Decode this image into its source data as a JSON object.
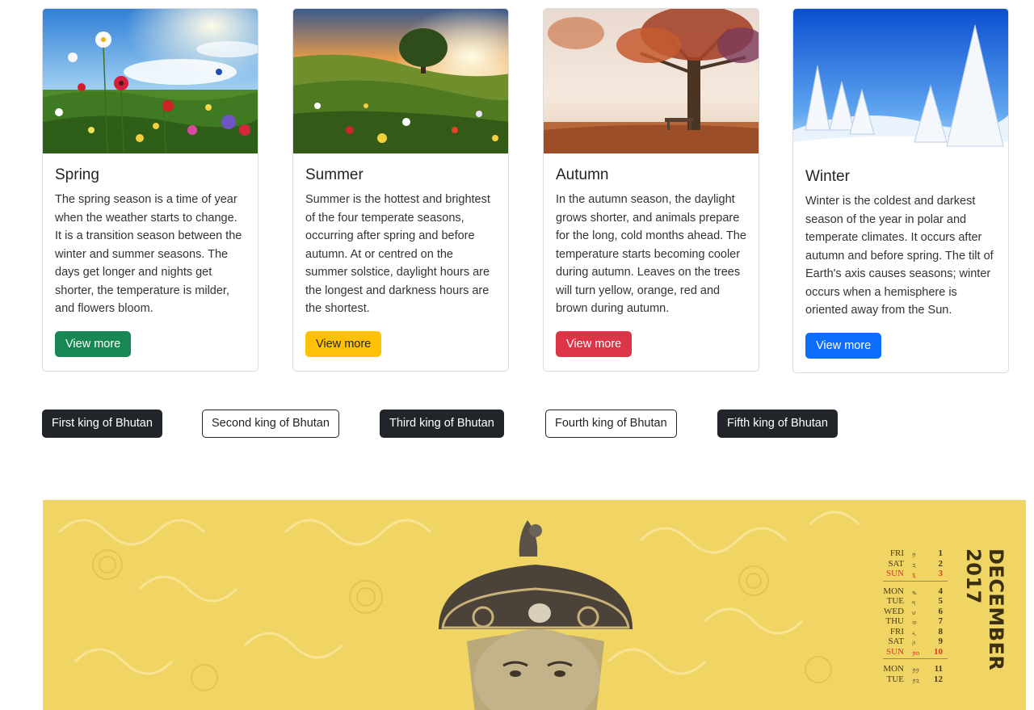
{
  "cards": [
    {
      "title": "Spring",
      "text": "The spring season is a time of year when the weather starts to change. It is a transition season between the winter and summer seasons. The days get longer and nights get shorter, the temperature is milder, and flowers bloom.",
      "button": "View more",
      "image": "spring meadow with red and white flowers under a bright sky"
    },
    {
      "title": "Summer",
      "text": "Summer is the hottest and brightest of the four temperate seasons, occurring after spring and before autumn. At or centred on the summer solstice, daylight hours are the longest and darkness hours are the shortest.",
      "button": "View more",
      "image": "summer wildflower field with a tree at sunset"
    },
    {
      "title": "Autumn",
      "text": "In the autumn season, the daylight grows shorter, and animals prepare for the long, cold months ahead. The temperature starts becoming cooler during autumn. Leaves on the trees will turn yellow, orange, red and brown during autumn.",
      "button": "View more",
      "image": "autumn tree with red leaves and a bench in fog"
    },
    {
      "title": "Winter",
      "text": "Winter is the coldest and darkest season of the year in polar and temperate climates. It occurs after autumn and before spring. The tilt of Earth's axis causes seasons; winter occurs when a hemisphere is oriented away from the Sun.",
      "button": "View more",
      "image": "snow covered fir trees under a blue sky"
    }
  ],
  "kings": [
    {
      "label": "First king of Bhutan",
      "style": "dark"
    },
    {
      "label": "Second king of Bhutan",
      "style": "outline"
    },
    {
      "label": "Third king of Bhutan",
      "style": "dark"
    },
    {
      "label": "Fourth king of Bhutan",
      "style": "outline"
    },
    {
      "label": "Fifth king of Bhutan",
      "style": "dark"
    }
  ],
  "banner": {
    "month": "DECEMBER 2017",
    "calendar": [
      {
        "day": "FRI",
        "tib": "༡",
        "num": "1",
        "sun": false
      },
      {
        "day": "SAT",
        "tib": "༢",
        "num": "2",
        "sun": false
      },
      {
        "day": "SUN",
        "tib": "༣",
        "num": "3",
        "sun": true
      },
      {
        "day": "MON",
        "tib": "༤",
        "num": "4",
        "sun": false
      },
      {
        "day": "TUE",
        "tib": "༥",
        "num": "5",
        "sun": false
      },
      {
        "day": "WED",
        "tib": "༦",
        "num": "6",
        "sun": false
      },
      {
        "day": "THU",
        "tib": "༧",
        "num": "7",
        "sun": false
      },
      {
        "day": "FRI",
        "tib": "༨",
        "num": "8",
        "sun": false
      },
      {
        "day": "SAT",
        "tib": "༩",
        "num": "9",
        "sun": false
      },
      {
        "day": "SUN",
        "tib": "༡༠",
        "num": "10",
        "sun": true
      },
      {
        "day": "MON",
        "tib": "༡༡",
        "num": "11",
        "sun": false
      },
      {
        "day": "TUE",
        "tib": "༡༢",
        "num": "12",
        "sun": false
      }
    ],
    "image": "illustrated portrait of a king wearing an ornate crown with a raven head on a yellow cloud pattern background"
  },
  "colors": {
    "success": "#198754",
    "warning": "#ffc107",
    "danger": "#dc3545",
    "primary": "#0d6efd",
    "dark": "#212529",
    "banner_bg": "#f1d564"
  }
}
